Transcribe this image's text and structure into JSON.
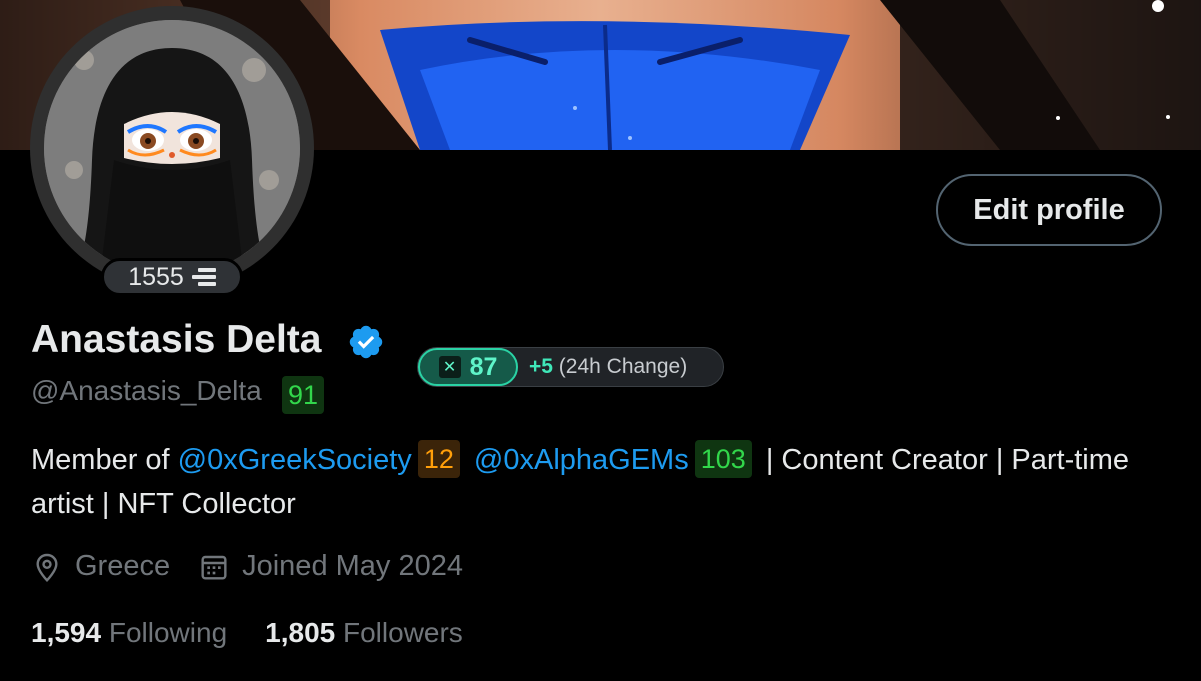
{
  "profile": {
    "display_name": "Anastasis Delta",
    "handle": "@Anastasis_Delta",
    "handle_score": "91",
    "avatar_badge_number": "1555",
    "edit_button_label": "Edit profile"
  },
  "score_pill": {
    "logo": "✕",
    "score": "87",
    "delta": "+5",
    "change_label": "(24h Change)"
  },
  "bio": {
    "prefix": "Member of",
    "mention1": "@0xGreekSociety",
    "mention1_score": "12",
    "mention2": "@0xAlphaGEMs",
    "mention2_score": "103",
    "suffix": "| Content Creator | Part-time artist | NFT Collector"
  },
  "meta": {
    "location": "Greece",
    "location_icon": "location-pin-icon",
    "joined": "Joined May 2024",
    "joined_icon": "calendar-icon"
  },
  "stats": {
    "following_count": "1,594",
    "following_label": "Following",
    "followers_count": "1,805",
    "followers_label": "Followers"
  },
  "colors": {
    "background": "#000000",
    "link": "#1d9bf0",
    "muted": "#71767b",
    "verified": "#1d9bf0",
    "score_accent": "#2ad3a5"
  }
}
